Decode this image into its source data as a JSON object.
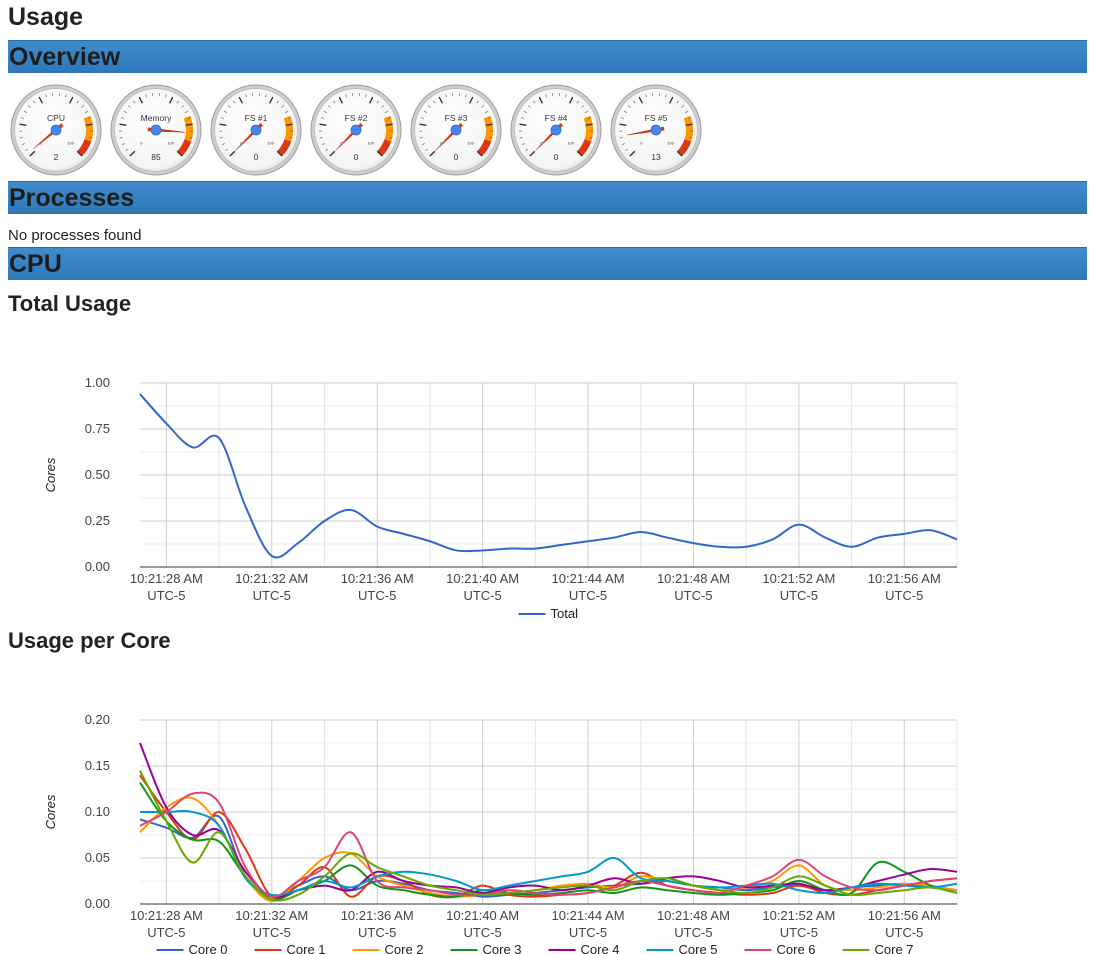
{
  "page": {
    "title": "Usage"
  },
  "sections": {
    "overview": "Overview",
    "processes": "Processes",
    "cpu": "CPU"
  },
  "processes": {
    "empty_message": "No processes found"
  },
  "gauges": [
    {
      "label": "CPU",
      "value": 2
    },
    {
      "label": "Memory",
      "value": 85
    },
    {
      "label": "FS #1",
      "value": 0
    },
    {
      "label": "FS #2",
      "value": 0
    },
    {
      "label": "FS #3",
      "value": 0
    },
    {
      "label": "FS #4",
      "value": 0
    },
    {
      "label": "FS #5",
      "value": 13
    }
  ],
  "gauge_scale": {
    "min_label": "0",
    "max_label": "100"
  },
  "colors": {
    "section_bar": "#3a86c6",
    "gauge_warning": "#ff9900",
    "gauge_danger": "#dc3912",
    "gauge_needle": "#dc3912",
    "gauge_hub": "#4684ee"
  },
  "chart_headings": {
    "total": "Total Usage",
    "per_core": "Usage per Core"
  },
  "chart_data": [
    {
      "type": "line",
      "title": "Total Usage",
      "xlabel": "",
      "ylabel": "Cores",
      "ylim": [
        0,
        1
      ],
      "y_ticks": [
        "0.00",
        "0.25",
        "0.50",
        "0.75",
        "1.00"
      ],
      "x_ticks": [
        [
          "10:21:28 AM",
          "UTC-5"
        ],
        [
          "10:21:32 AM",
          "UTC-5"
        ],
        [
          "10:21:36 AM",
          "UTC-5"
        ],
        [
          "10:21:40 AM",
          "UTC-5"
        ],
        [
          "10:21:44 AM",
          "UTC-5"
        ],
        [
          "10:21:48 AM",
          "UTC-5"
        ],
        [
          "10:21:52 AM",
          "UTC-5"
        ],
        [
          "10:21:56 AM",
          "UTC-5"
        ]
      ],
      "x": [
        "10:21:27",
        "10:21:28",
        "10:21:29",
        "10:21:30",
        "10:21:31",
        "10:21:32",
        "10:21:33",
        "10:21:34",
        "10:21:35",
        "10:21:36",
        "10:21:37",
        "10:21:38",
        "10:21:39",
        "10:21:40",
        "10:21:41",
        "10:21:42",
        "10:21:43",
        "10:21:44",
        "10:21:45",
        "10:21:46",
        "10:21:47",
        "10:21:48",
        "10:21:49",
        "10:21:50",
        "10:21:51",
        "10:21:52",
        "10:21:53",
        "10:21:54",
        "10:21:55",
        "10:21:56",
        "10:21:57",
        "10:21:58"
      ],
      "legend_position": "bottom",
      "grid": true,
      "series": [
        {
          "name": "Total",
          "color": "#3366cc",
          "values": [
            0.94,
            0.78,
            0.65,
            0.7,
            0.33,
            0.06,
            0.13,
            0.25,
            0.31,
            0.22,
            0.18,
            0.14,
            0.09,
            0.09,
            0.1,
            0.1,
            0.12,
            0.14,
            0.16,
            0.19,
            0.16,
            0.13,
            0.11,
            0.11,
            0.15,
            0.23,
            0.16,
            0.11,
            0.16,
            0.18,
            0.2,
            0.15
          ]
        }
      ]
    },
    {
      "type": "line",
      "title": "Usage per Core",
      "xlabel": "",
      "ylabel": "Cores",
      "ylim": [
        0,
        0.2
      ],
      "y_ticks": [
        "0.00",
        "0.05",
        "0.10",
        "0.15",
        "0.20"
      ],
      "x_ticks": [
        [
          "10:21:28 AM",
          "UTC-5"
        ],
        [
          "10:21:32 AM",
          "UTC-5"
        ],
        [
          "10:21:36 AM",
          "UTC-5"
        ],
        [
          "10:21:40 AM",
          "UTC-5"
        ],
        [
          "10:21:44 AM",
          "UTC-5"
        ],
        [
          "10:21:48 AM",
          "UTC-5"
        ],
        [
          "10:21:52 AM",
          "UTC-5"
        ],
        [
          "10:21:56 AM",
          "UTC-5"
        ]
      ],
      "x": [
        "10:21:27",
        "10:21:28",
        "10:21:29",
        "10:21:30",
        "10:21:31",
        "10:21:32",
        "10:21:33",
        "10:21:34",
        "10:21:35",
        "10:21:36",
        "10:21:37",
        "10:21:38",
        "10:21:39",
        "10:21:40",
        "10:21:41",
        "10:21:42",
        "10:21:43",
        "10:21:44",
        "10:21:45",
        "10:21:46",
        "10:21:47",
        "10:21:48",
        "10:21:49",
        "10:21:50",
        "10:21:51",
        "10:21:52",
        "10:21:53",
        "10:21:54",
        "10:21:55",
        "10:21:56",
        "10:21:57",
        "10:21:58"
      ],
      "legend_position": "bottom",
      "grid": true,
      "series": [
        {
          "name": "Core 0",
          "color": "#3366cc",
          "values": [
            0.092,
            0.083,
            0.072,
            0.095,
            0.03,
            0.008,
            0.02,
            0.03,
            0.015,
            0.025,
            0.022,
            0.015,
            0.012,
            0.008,
            0.01,
            0.012,
            0.015,
            0.018,
            0.02,
            0.022,
            0.025,
            0.02,
            0.018,
            0.015,
            0.018,
            0.02,
            0.015,
            0.018,
            0.02,
            0.022,
            0.018,
            0.015
          ]
        },
        {
          "name": "Core 1",
          "color": "#dc3912",
          "values": [
            0.14,
            0.1,
            0.07,
            0.1,
            0.06,
            0.008,
            0.02,
            0.04,
            0.008,
            0.03,
            0.025,
            0.01,
            0.008,
            0.02,
            0.01,
            0.008,
            0.01,
            0.012,
            0.02,
            0.034,
            0.02,
            0.015,
            0.012,
            0.01,
            0.012,
            0.02,
            0.012,
            0.01,
            0.015,
            0.02,
            0.025,
            0.028
          ]
        },
        {
          "name": "Core 2",
          "color": "#ff9900",
          "values": [
            0.078,
            0.105,
            0.115,
            0.085,
            0.03,
            0.003,
            0.025,
            0.05,
            0.055,
            0.03,
            0.02,
            0.012,
            0.008,
            0.01,
            0.012,
            0.015,
            0.02,
            0.022,
            0.018,
            0.03,
            0.025,
            0.02,
            0.015,
            0.018,
            0.025,
            0.042,
            0.02,
            0.015,
            0.018,
            0.022,
            0.02,
            0.015
          ]
        },
        {
          "name": "Core 3",
          "color": "#109618",
          "values": [
            0.132,
            0.09,
            0.07,
            0.068,
            0.03,
            0.005,
            0.015,
            0.025,
            0.042,
            0.02,
            0.015,
            0.01,
            0.008,
            0.015,
            0.012,
            0.01,
            0.012,
            0.015,
            0.012,
            0.018,
            0.015,
            0.012,
            0.01,
            0.012,
            0.015,
            0.025,
            0.015,
            0.012,
            0.045,
            0.035,
            0.02,
            0.012
          ]
        },
        {
          "name": "Core 4",
          "color": "#990099",
          "values": [
            0.175,
            0.105,
            0.075,
            0.08,
            0.035,
            0.008,
            0.015,
            0.02,
            0.015,
            0.035,
            0.025,
            0.02,
            0.018,
            0.012,
            0.018,
            0.02,
            0.015,
            0.02,
            0.028,
            0.022,
            0.028,
            0.03,
            0.025,
            0.018,
            0.02,
            0.022,
            0.015,
            0.018,
            0.025,
            0.032,
            0.038,
            0.035
          ]
        },
        {
          "name": "Core 5",
          "color": "#0099c6",
          "values": [
            0.1,
            0.1,
            0.1,
            0.085,
            0.028,
            0.01,
            0.015,
            0.025,
            0.018,
            0.03,
            0.035,
            0.032,
            0.025,
            0.015,
            0.02,
            0.025,
            0.03,
            0.035,
            0.05,
            0.028,
            0.025,
            0.02,
            0.018,
            0.02,
            0.022,
            0.015,
            0.012,
            0.018,
            0.022,
            0.02,
            0.018,
            0.022
          ]
        },
        {
          "name": "Core 6",
          "color": "#dd4477",
          "values": [
            0.085,
            0.1,
            0.12,
            0.11,
            0.04,
            0.008,
            0.025,
            0.04,
            0.078,
            0.025,
            0.018,
            0.015,
            0.01,
            0.01,
            0.015,
            0.012,
            0.01,
            0.012,
            0.018,
            0.025,
            0.02,
            0.015,
            0.012,
            0.02,
            0.03,
            0.048,
            0.03,
            0.018,
            0.015,
            0.02,
            0.025,
            0.028
          ]
        },
        {
          "name": "Core 7",
          "color": "#66aa00",
          "values": [
            0.145,
            0.09,
            0.045,
            0.078,
            0.03,
            0.005,
            0.01,
            0.03,
            0.055,
            0.04,
            0.03,
            0.02,
            0.015,
            0.01,
            0.012,
            0.015,
            0.018,
            0.02,
            0.015,
            0.025,
            0.028,
            0.02,
            0.015,
            0.012,
            0.018,
            0.03,
            0.02,
            0.01,
            0.012,
            0.015,
            0.018,
            0.012
          ]
        }
      ]
    }
  ]
}
